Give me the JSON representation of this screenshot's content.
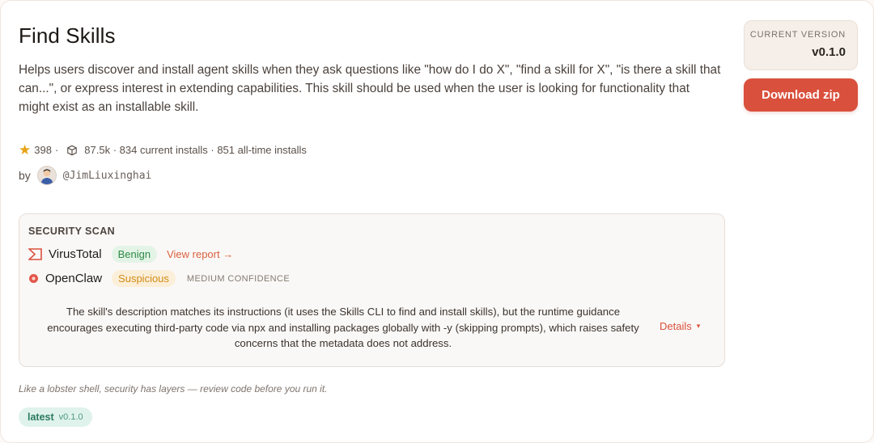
{
  "skill": {
    "title": "Find Skills",
    "description": "Helps users discover and install agent skills when they ask questions like \"how do I do X\", \"find a skill for X\", \"is there a skill that can...\", or express interest in extending capabilities. This skill should be used when the user is looking for functionality that might exist as an installable skill."
  },
  "stats": {
    "stars": "398",
    "separator": "·",
    "installs_text": "87.5k · 834 current installs · 851 all-time installs"
  },
  "author": {
    "prefix": "by",
    "handle": "@JimLiuxinghai"
  },
  "version": {
    "label": "CURRENT VERSION",
    "value": "v0.1.0"
  },
  "download": {
    "label": "Download zip"
  },
  "security": {
    "title": "SECURITY SCAN",
    "virustotal": {
      "name": "VirusTotal",
      "verdict": "Benign",
      "link": "View report →"
    },
    "openclaw": {
      "name": "OpenClaw",
      "verdict": "Suspicious",
      "confidence": "MEDIUM CONFIDENCE"
    },
    "summary": "The skill's description matches its instructions (it uses the Skills CLI to find and install skills), but the runtime guidance encourages executing third-party code via npx and installing packages globally with -y (skipping prompts), which raises safety concerns that the metadata does not address.",
    "details_label": "Details",
    "details_caret": "▾"
  },
  "footnote": "Like a lobster shell, security has layers — review code before you run it.",
  "tag": {
    "name": "latest",
    "version": "v0.1.0"
  },
  "colors": {
    "accent": "#d9503c",
    "benign": "#2f8a45",
    "suspicious": "#d18b16",
    "tag_bg": "#dff3ec"
  },
  "icons": {
    "star": "star-icon",
    "installs": "package-icon",
    "virustotal": "virustotal-icon",
    "openclaw": "openclaw-icon"
  }
}
